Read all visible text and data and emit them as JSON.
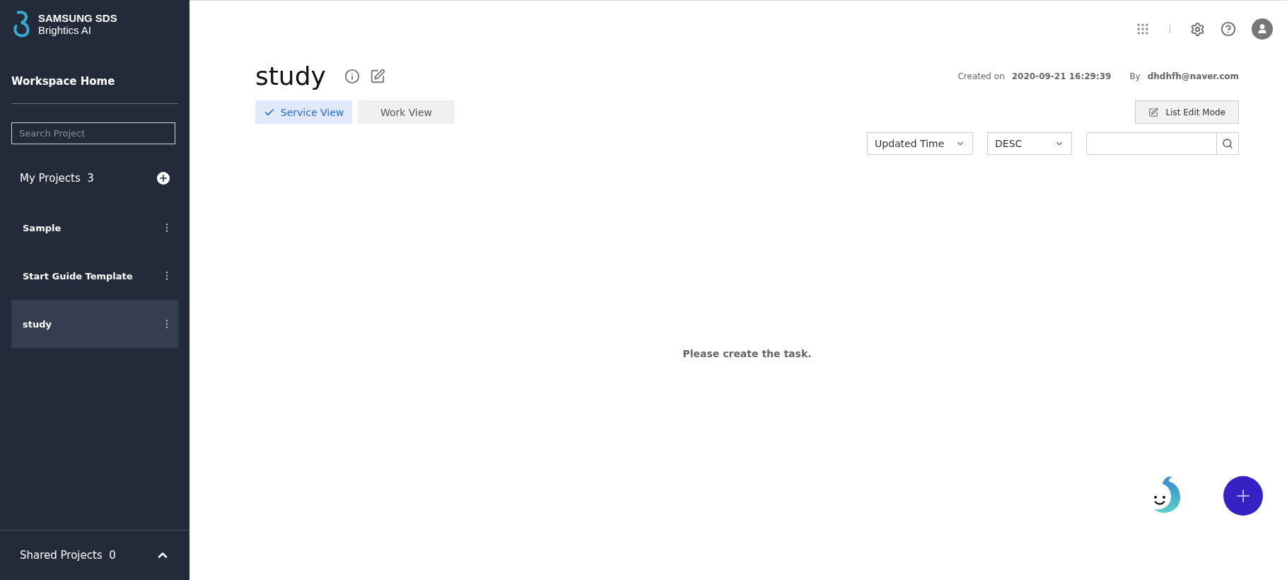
{
  "logo": {
    "line_1": "SAMSUNG SDS",
    "line_2": "Brightics AI"
  },
  "sidebar": {
    "home": "Workspace Home",
    "search": {
      "placeholder": "Search Project"
    },
    "my_projects": {
      "label": "My Projects",
      "count": "3"
    },
    "items": [
      {
        "label": "Sample",
        "selected": false
      },
      {
        "label": "Start Guide Template",
        "selected": false
      },
      {
        "label": "study",
        "selected": true
      }
    ],
    "shared_projects": {
      "label": "Shared Projects",
      "count": "0"
    }
  },
  "project": {
    "title": "study",
    "created_label": "Created on",
    "created_value": "2020-09-21 16:29:39",
    "by_label": "By",
    "by_value": "dhdhfh@naver.com"
  },
  "tabs": [
    {
      "label": "Service View",
      "selected": true
    },
    {
      "label": "Work View",
      "selected": false
    }
  ],
  "list_edit_button": "List Edit Mode",
  "sort_field": "Updated Time",
  "sort_order": "DESC",
  "empty_message": "Please create the task."
}
